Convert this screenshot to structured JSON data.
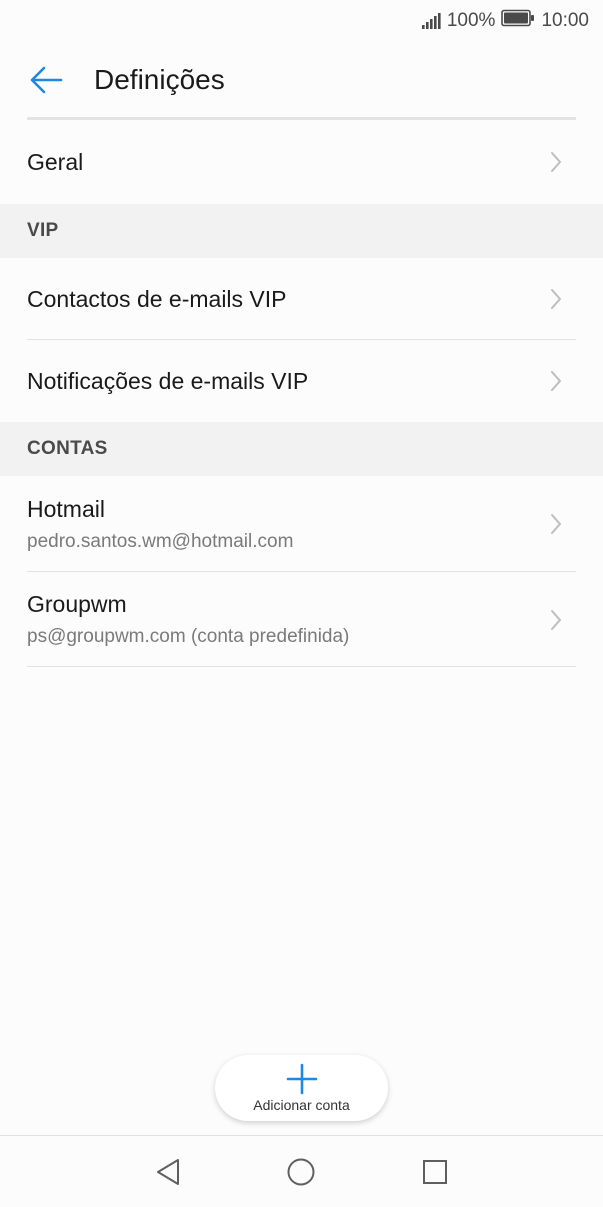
{
  "status": {
    "battery": "100%",
    "time": "10:00"
  },
  "header": {
    "title": "Definições"
  },
  "items": {
    "general": "Geral",
    "vip_header": "VIP",
    "vip_contacts": "Contactos de e-mails VIP",
    "vip_notifications": "Notificações de e-mails VIP",
    "accounts_header": "CONTAS",
    "accounts": [
      {
        "name": "Hotmail",
        "email": "pedro.santos.wm@hotmail.com"
      },
      {
        "name": "Groupwm",
        "email": "ps@groupwm.com (conta predefinida)"
      }
    ]
  },
  "fab": {
    "label": "Adicionar conta"
  },
  "colors": {
    "accent": "#1e88e5",
    "section_bg": "#f2f2f2",
    "chevron": "#bdbdbd"
  }
}
